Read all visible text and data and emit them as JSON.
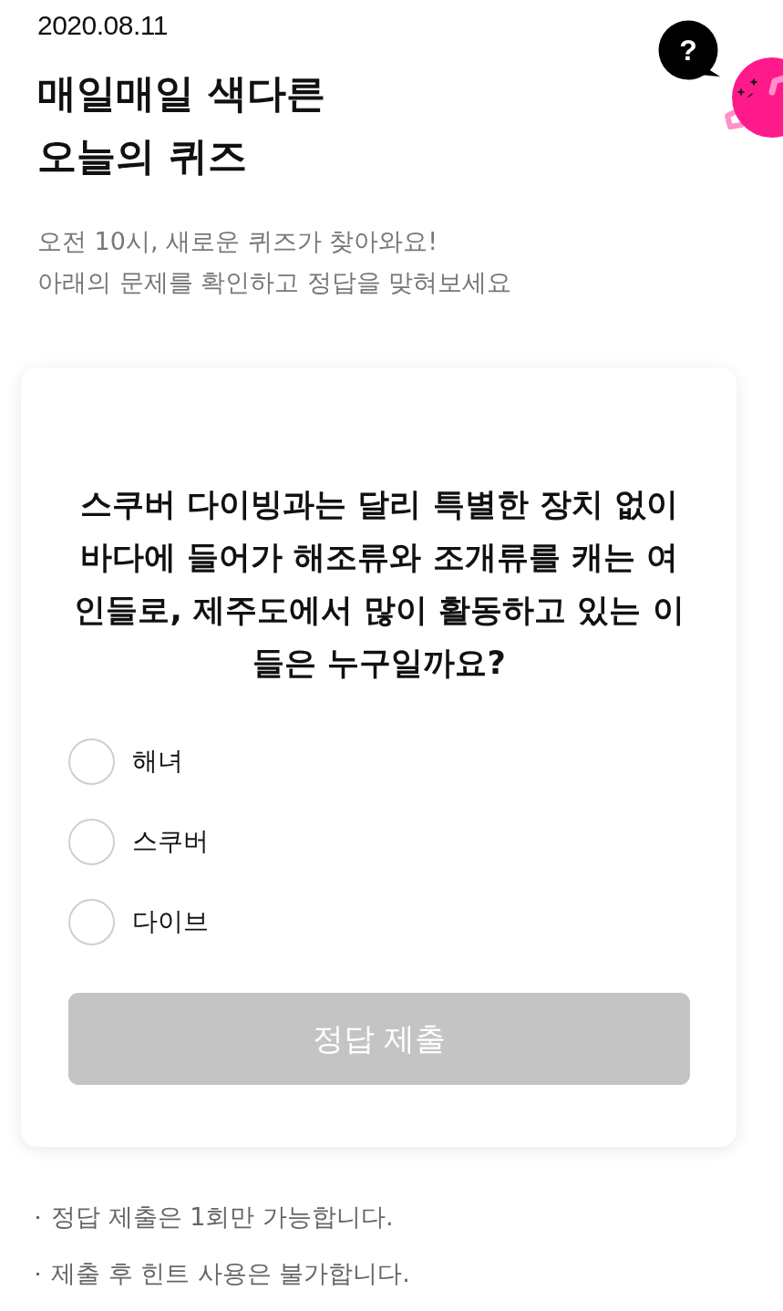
{
  "date": "2020.08.11",
  "title_lines": [
    "매일매일 색다른",
    "오늘의 퀴즈"
  ],
  "subtitle_lines": [
    "오전 10시, 새로운 퀴즈가 찾아와요!",
    "아래의 문제를 확인하고 정답을 맞혀보세요"
  ],
  "help_button": {
    "label": "?"
  },
  "quiz": {
    "question": "스쿠버 다이빙과는 달리 특별한 장치 없이 바다에 들어가 해조류와 조개류를 캐는 여인들로, 제주도에서 많이 활동하고 있는 이들은 누구일까요?",
    "options": [
      {
        "label": "해녀",
        "selected": false
      },
      {
        "label": "스쿠버",
        "selected": false
      },
      {
        "label": "다이브",
        "selected": false
      }
    ],
    "submit": {
      "label": "정답 제출",
      "disabled": true
    }
  },
  "notes": [
    "정답 제출은 1회만 가능합니다.",
    "제출 후 힌트 사용은 불가합니다."
  ]
}
